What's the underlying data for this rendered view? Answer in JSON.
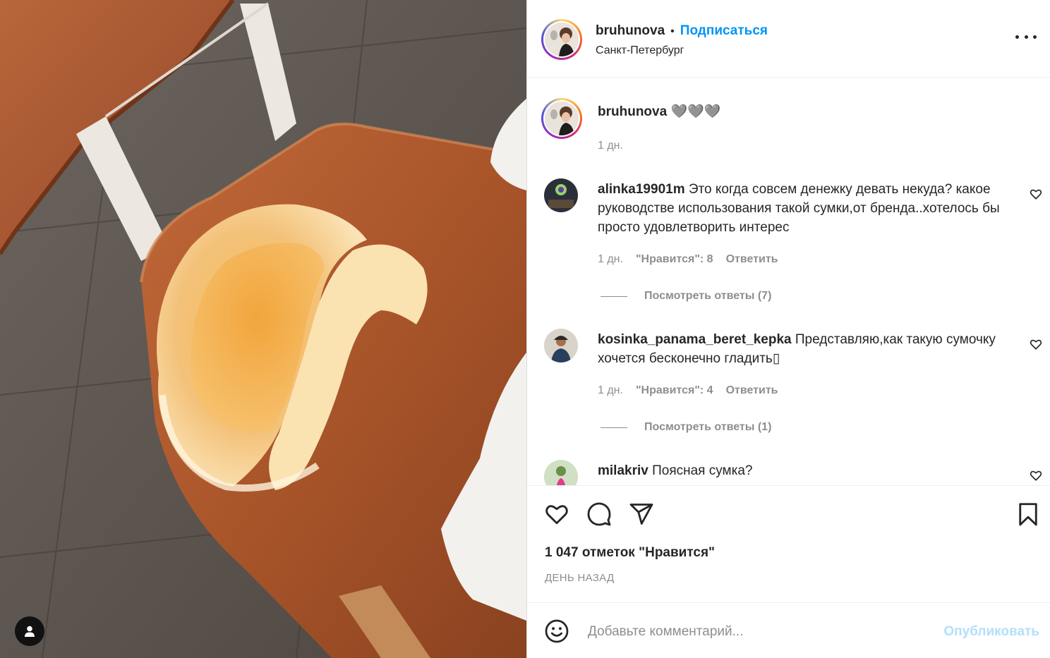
{
  "post": {
    "username": "bruhunova",
    "dot": "•",
    "follow_label": "Подписаться",
    "location": "Санкт-Петербург",
    "caption_user": "bruhunova",
    "caption_text": "🩶🩶🩶",
    "caption_time": "1 дн."
  },
  "comments": [
    {
      "user": "alinka19901m",
      "text": "Это когда совсем денежку девать некуда? какое руководстве использования такой сумки,от бренда..хотелось бы просто удовлетворить интерес",
      "time": "1 дн.",
      "likes": "\"Нравится\": 8",
      "reply": "Ответить",
      "view_replies": "Посмотреть ответы (7)"
    },
    {
      "user": "kosinka_panama_beret_kepka",
      "text": "Представляю,как такую сумочку хочется бесконечно гладить▯",
      "time": "1 дн.",
      "likes": "\"Нравится\": 4",
      "reply": "Ответить",
      "view_replies": "Посмотреть ответы (1)"
    },
    {
      "user": "milakriv",
      "text": "Поясная сумка?"
    }
  ],
  "footer": {
    "likes_count": "1 047 отметок \"Нравится\"",
    "posted": "ДЕНЬ НАЗАД",
    "comment_placeholder": "Добавьте комментарий...",
    "publish_label": "Опубликовать"
  },
  "icons": {
    "like": "heart-icon",
    "comment": "comment-bubble-icon",
    "share": "paper-plane-icon",
    "save": "bookmark-icon",
    "emoji": "smiley-icon",
    "more": "more-horizontal-icon",
    "tags": "user-tag-icon"
  },
  "colors": {
    "link_blue": "#0095f6",
    "publish_disabled": "#b2dffc",
    "secondary_text": "#8e8e8e"
  }
}
